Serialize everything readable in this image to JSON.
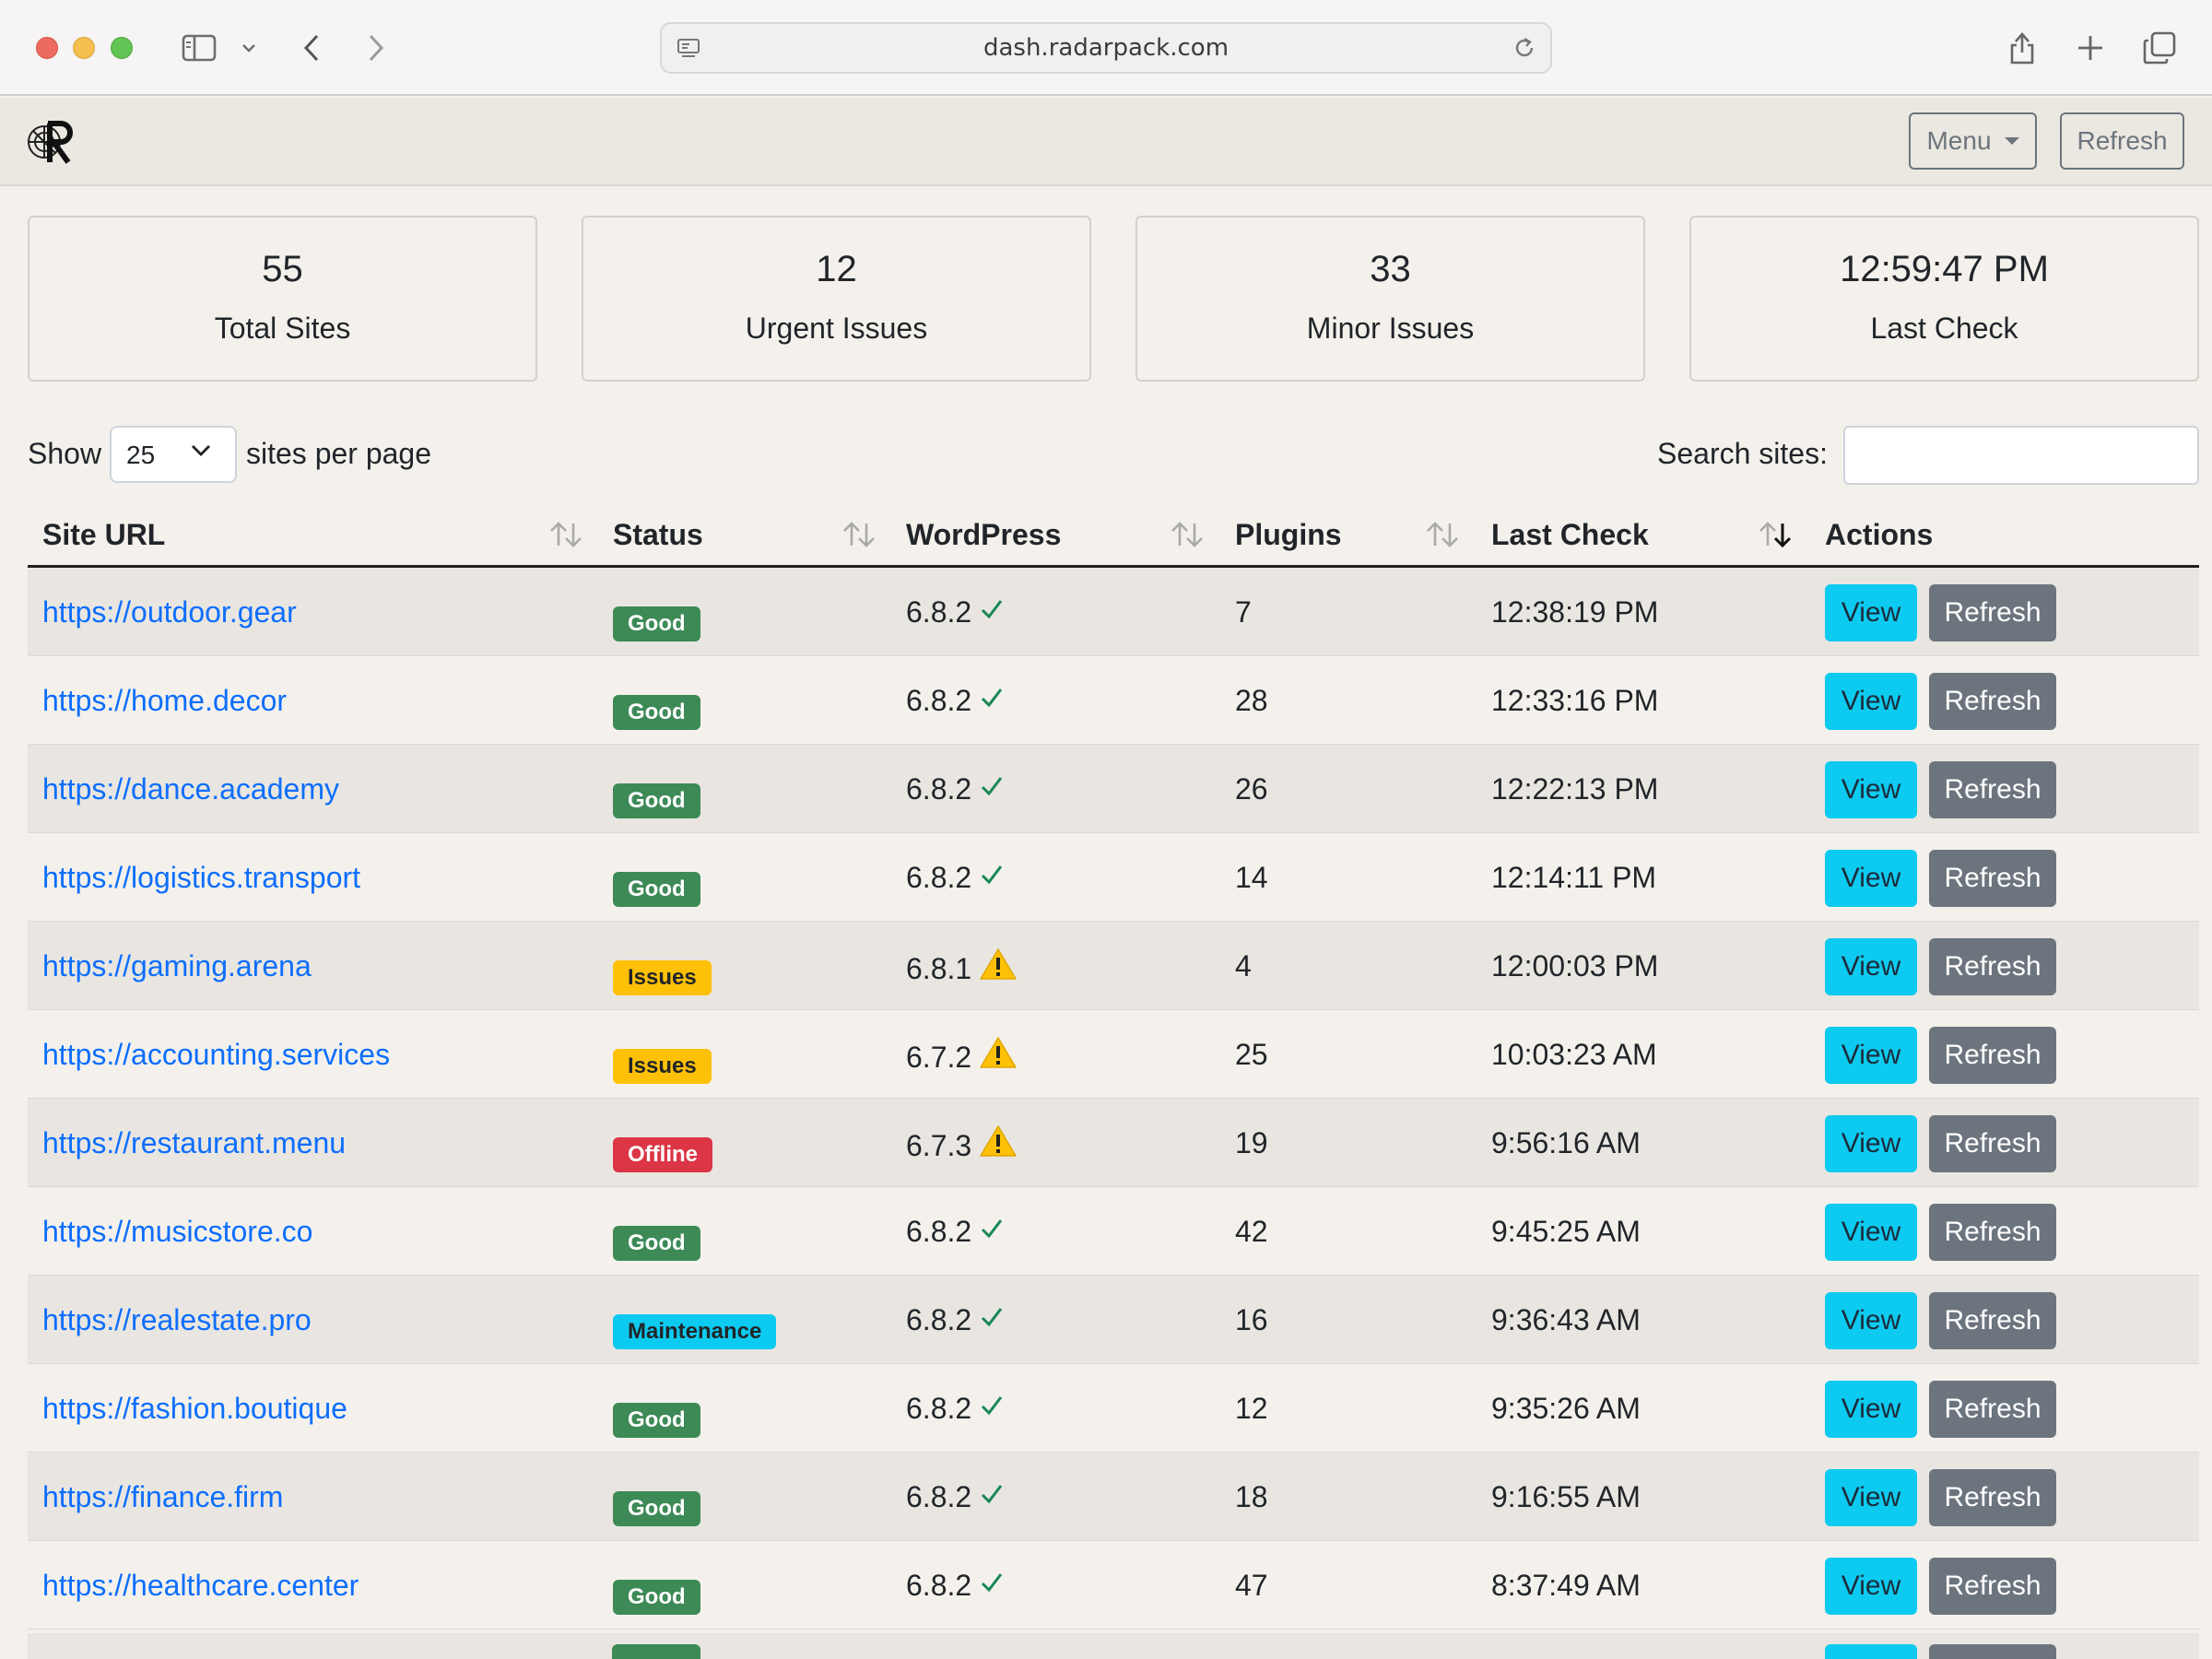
{
  "browser": {
    "url": "dash.radarpack.com"
  },
  "header": {
    "menu_label": "Menu",
    "refresh_label": "Refresh"
  },
  "stats": [
    {
      "value": "55",
      "label": "Total Sites"
    },
    {
      "value": "12",
      "label": "Urgent Issues"
    },
    {
      "value": "33",
      "label": "Minor Issues"
    },
    {
      "value": "12:59:47 PM",
      "label": "Last Check"
    }
  ],
  "controls": {
    "show_label": "Show",
    "per_page": "25",
    "per_page_suffix": "sites per page",
    "search_label": "Search sites:",
    "search_value": ""
  },
  "table": {
    "columns": [
      "Site URL",
      "Status",
      "WordPress",
      "Plugins",
      "Last Check",
      "Actions"
    ],
    "view_label": "View",
    "refresh_label": "Refresh",
    "rows": [
      {
        "url": "https://outdoor.gear",
        "status": "Good",
        "wp": "6.8.2",
        "wp_state": "ok",
        "plugins": "7",
        "last_check": "12:38:19 PM"
      },
      {
        "url": "https://home.decor",
        "status": "Good",
        "wp": "6.8.2",
        "wp_state": "ok",
        "plugins": "28",
        "last_check": "12:33:16 PM"
      },
      {
        "url": "https://dance.academy",
        "status": "Good",
        "wp": "6.8.2",
        "wp_state": "ok",
        "plugins": "26",
        "last_check": "12:22:13 PM"
      },
      {
        "url": "https://logistics.transport",
        "status": "Good",
        "wp": "6.8.2",
        "wp_state": "ok",
        "plugins": "14",
        "last_check": "12:14:11 PM"
      },
      {
        "url": "https://gaming.arena",
        "status": "Issues",
        "wp": "6.8.1",
        "wp_state": "warn",
        "plugins": "4",
        "last_check": "12:00:03 PM"
      },
      {
        "url": "https://accounting.services",
        "status": "Issues",
        "wp": "6.7.2",
        "wp_state": "warn",
        "plugins": "25",
        "last_check": "10:03:23 AM"
      },
      {
        "url": "https://restaurant.menu",
        "status": "Offline",
        "wp": "6.7.3",
        "wp_state": "warn",
        "plugins": "19",
        "last_check": "9:56:16 AM"
      },
      {
        "url": "https://musicstore.co",
        "status": "Good",
        "wp": "6.8.2",
        "wp_state": "ok",
        "plugins": "42",
        "last_check": "9:45:25 AM"
      },
      {
        "url": "https://realestate.pro",
        "status": "Maintenance",
        "wp": "6.8.2",
        "wp_state": "ok",
        "plugins": "16",
        "last_check": "9:36:43 AM"
      },
      {
        "url": "https://fashion.boutique",
        "status": "Good",
        "wp": "6.8.2",
        "wp_state": "ok",
        "plugins": "12",
        "last_check": "9:35:26 AM"
      },
      {
        "url": "https://finance.firm",
        "status": "Good",
        "wp": "6.8.2",
        "wp_state": "ok",
        "plugins": "18",
        "last_check": "9:16:55 AM"
      },
      {
        "url": "https://healthcare.center",
        "status": "Good",
        "wp": "6.8.2",
        "wp_state": "ok",
        "plugins": "47",
        "last_check": "8:37:49 AM"
      }
    ]
  },
  "colors": {
    "good": "#3d8a57",
    "issues": "#ffc107",
    "offline": "#dc3545",
    "maintenance": "#0dcaf0",
    "link": "#0d6efd"
  }
}
